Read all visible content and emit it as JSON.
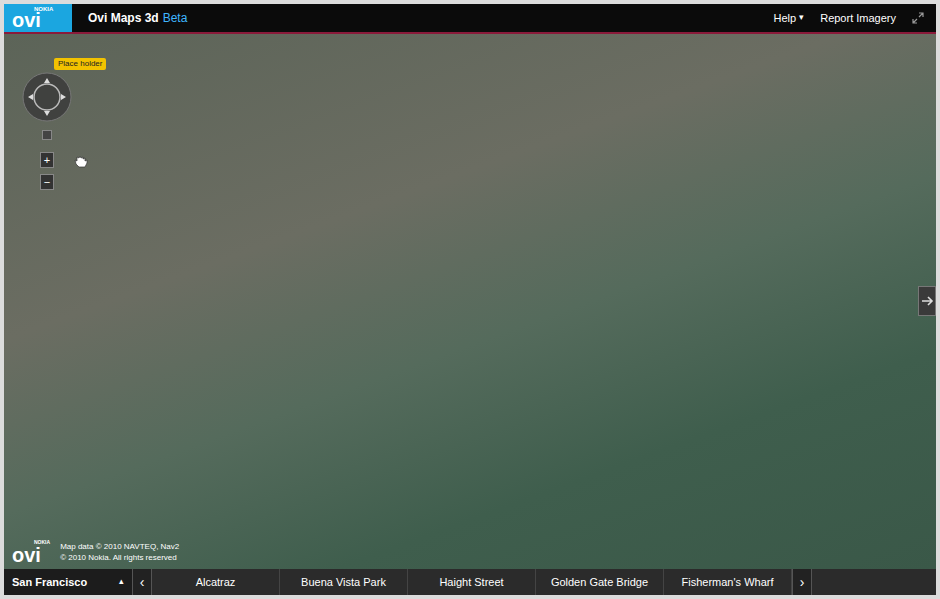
{
  "header": {
    "logo": "ovi",
    "logo_brand": "NOKIA",
    "title": "Ovi Maps 3d",
    "badge": "Beta",
    "help": "Help",
    "help_arrow": "▾",
    "report": "Report Imagery"
  },
  "map": {
    "tooltip": "Place holder",
    "zoom_in": "+",
    "zoom_out": "−",
    "footer_logo": "ovi",
    "footer_brand": "NOKIA",
    "attribution": [
      "Map data © 2010 NAVTEQ, Nav2",
      "© 2010 Nokia. All rights reserved"
    ]
  },
  "bottom_bar": {
    "city": "San Francisco",
    "city_arrow": "▴",
    "prev": "‹",
    "next": "›",
    "places": [
      "Alcatraz",
      "Buena Vista Park",
      "Haight Street",
      "Golden Gate Bridge",
      "Fisherman's Wharf"
    ]
  }
}
